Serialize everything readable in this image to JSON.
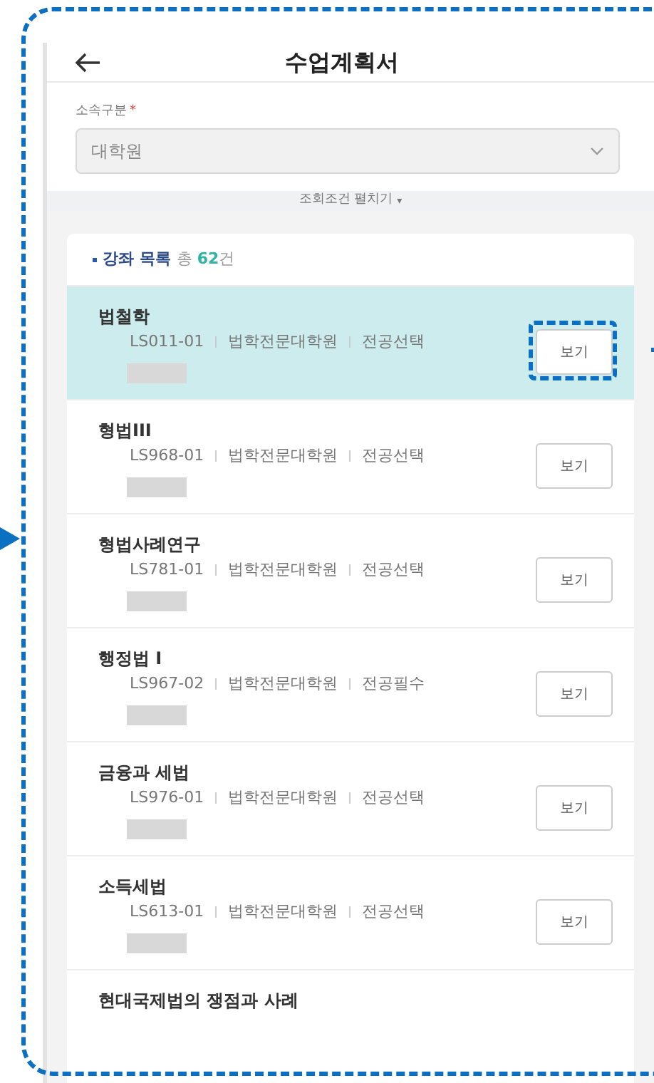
{
  "header": {
    "title": "수업계획서"
  },
  "filter": {
    "label": "소속구분",
    "required_mark": "*",
    "select_value": "대학원",
    "expand_label": "조회조건 펼치기",
    "expand_icon": "▾"
  },
  "list": {
    "title": "강좌 목록",
    "total_prefix": "총",
    "total_count": "62",
    "total_suffix": "건",
    "rows": [
      {
        "name": "법철학",
        "code": "LS011-01",
        "dept": "법학전문대학원",
        "type": "전공선택",
        "button": "보기",
        "selected": true
      },
      {
        "name": "형법III",
        "code": "LS968-01",
        "dept": "법학전문대학원",
        "type": "전공선택",
        "button": "보기",
        "selected": false
      },
      {
        "name": "형법사례연구",
        "code": "LS781-01",
        "dept": "법학전문대학원",
        "type": "전공선택",
        "button": "보기",
        "selected": false
      },
      {
        "name": "행정법 I",
        "code": "LS967-02",
        "dept": "법학전문대학원",
        "type": "전공필수",
        "button": "보기",
        "selected": false
      },
      {
        "name": "금융과 세법",
        "code": "LS976-01",
        "dept": "법학전문대학원",
        "type": "전공선택",
        "button": "보기",
        "selected": false
      },
      {
        "name": "소득세법",
        "code": "LS613-01",
        "dept": "법학전문대학원",
        "type": "전공선택",
        "button": "보기",
        "selected": false
      },
      {
        "name": "현대국제법의 쟁점과 사례",
        "selected": false
      }
    ]
  }
}
